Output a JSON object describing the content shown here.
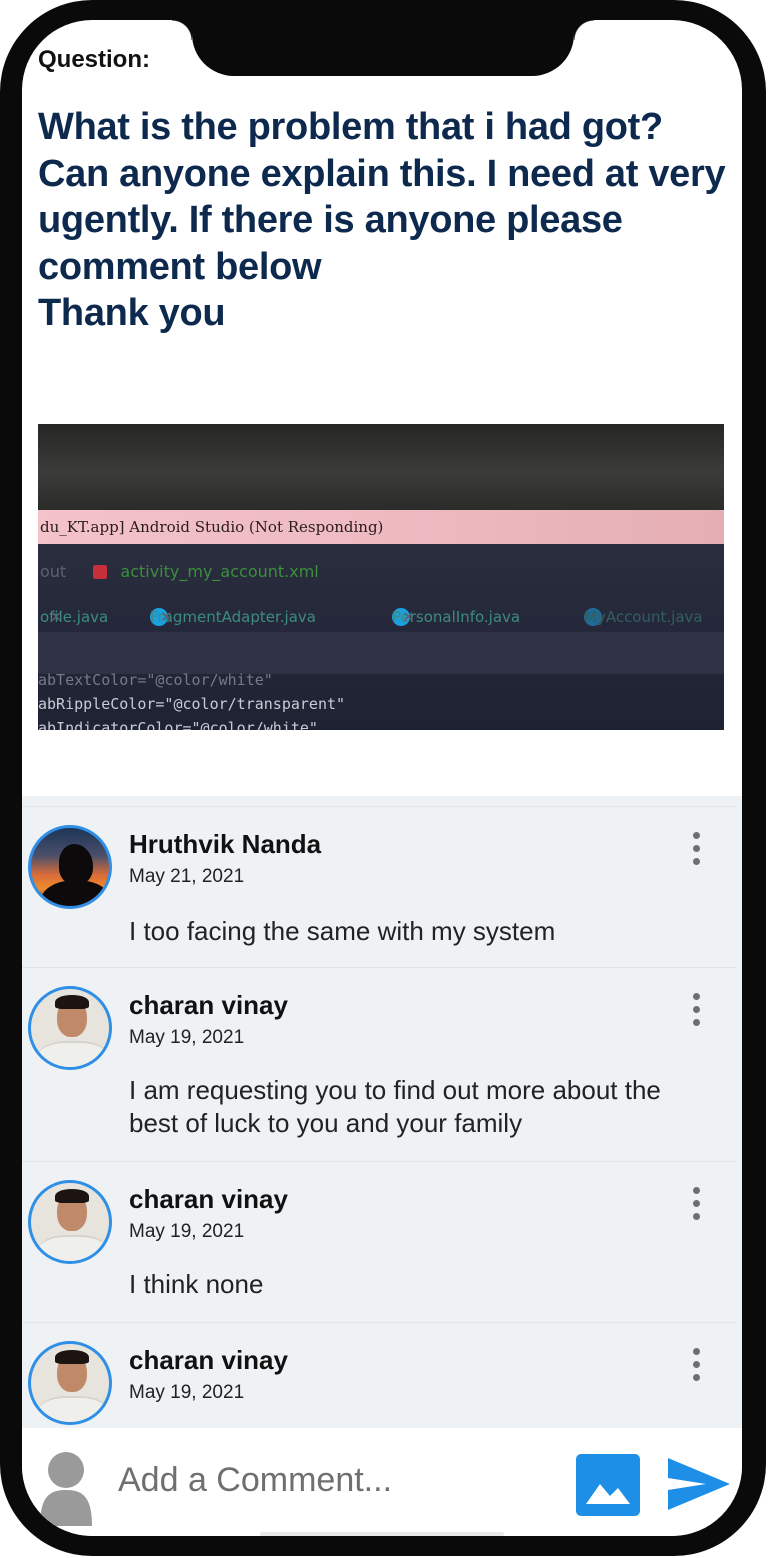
{
  "question": {
    "label": "Question:",
    "text": "What is the problem that i had got?\nCan anyone explain this. I need at very ugently. If there is anyone please comment below\nThank you"
  },
  "photo": {
    "titlebar": "du_KT.app] Android Studio (Not Responding)",
    "breadcrumb_prefix": "out",
    "breadcrumb_file": "activity_my_account.xml",
    "tabs": [
      "ofile.java",
      "FragmentAdapter.java",
      "PersonalInfo.java",
      "MyAccount.java"
    ],
    "code_lines": [
      "abTextColor=\"@color/white\"",
      "abRippleColor=\"@color/transparent\"",
      "abIndicatorColor=\"@color/white\""
    ]
  },
  "comments": [
    {
      "name": "Hruthvik Nanda",
      "date": "May 21, 2021",
      "text": "I too facing the same with my system",
      "avatar": "sunset-silhouette"
    },
    {
      "name": "charan vinay",
      "date": "May 19, 2021",
      "text": "I am requesting you to find out more about the best of luck to you and your family",
      "avatar": "person-photo"
    },
    {
      "name": "charan vinay",
      "date": "May 19, 2021",
      "text": "I think none",
      "avatar": "person-photo"
    },
    {
      "name": "charan vinay",
      "date": "May 19, 2021",
      "text": "",
      "avatar": "person-photo"
    }
  ],
  "composer": {
    "placeholder": "Add a Comment...",
    "icons": [
      "user-placeholder-icon",
      "image-icon",
      "send-icon"
    ]
  },
  "colors": {
    "question_text": "#0d2a4e",
    "avatar_border": "#2f8fe6",
    "accent": "#1e8fe6",
    "comments_bg": "#eff2f5"
  }
}
